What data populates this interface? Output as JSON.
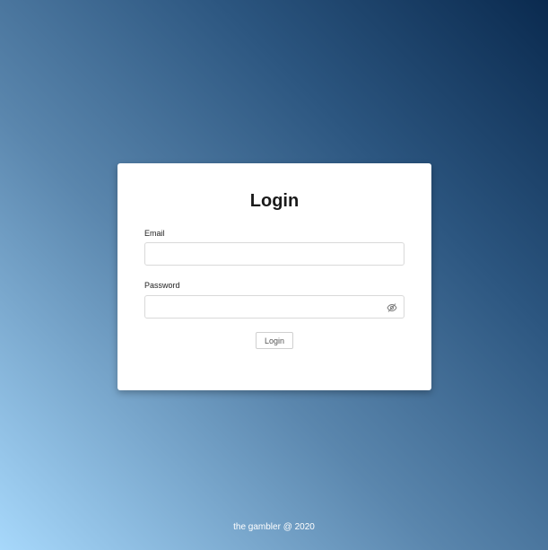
{
  "login_card": {
    "title": "Login",
    "email_label": "Email",
    "email_value": "",
    "email_placeholder": "",
    "password_label": "Password",
    "password_value": "",
    "password_placeholder": "",
    "password_toggle_icon": "eye-off-icon",
    "submit_label": "Login"
  },
  "footer": {
    "text": "the gambler @ 2020"
  },
  "colors": {
    "gradient_light": "#a7d8fb",
    "gradient_dark": "#0a2a4f",
    "card_background": "#ffffff"
  }
}
